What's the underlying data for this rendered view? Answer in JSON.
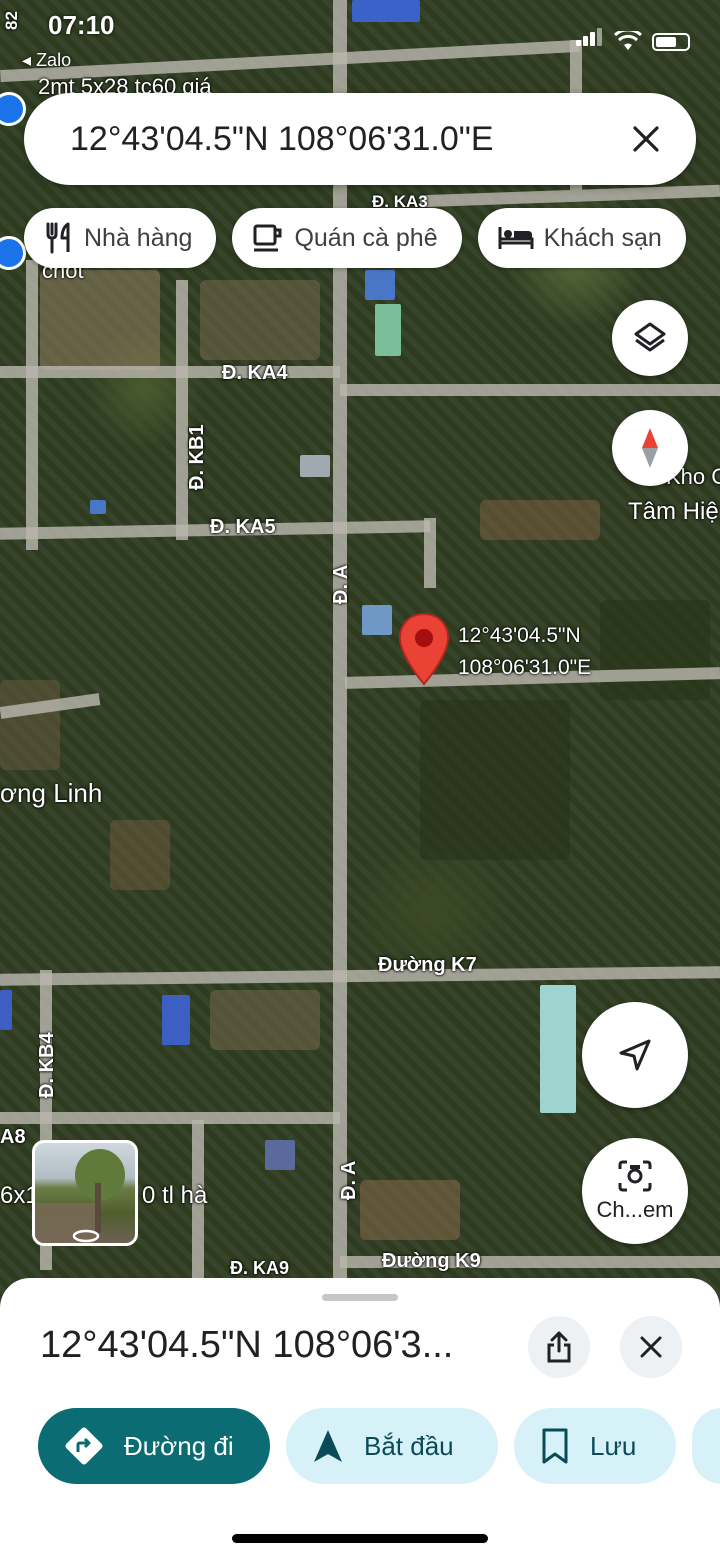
{
  "status": {
    "time": "07:10",
    "back_app": "Zalo"
  },
  "search": {
    "query": "12°43'04.5\"N 108°06'31.0\"E"
  },
  "chips": [
    {
      "icon": "restaurant-icon",
      "label": "Nhà hàng"
    },
    {
      "icon": "coffee-icon",
      "label": "Quán cà phê"
    },
    {
      "icon": "hotel-bed-icon",
      "label": "Khách sạn"
    }
  ],
  "map": {
    "labels": {
      "top_snippet": "2mt 5x28 tc60 giá",
      "chot": "chốt",
      "ka3": "Đ. KA3",
      "ka4": "Đ. KA4",
      "kb1": "Đ. KB1",
      "ka5": "Đ. KA5",
      "da_top": "Đ. A",
      "da_bottom": "Đ. A",
      "kho": "Kho C",
      "tam_hiep": "Tâm Hiệ",
      "linh": "ơng Linh",
      "k7": "Đường K7",
      "kb4": "Đ. KB4",
      "a8": "A8",
      "snippet_6x": "6x1",
      "snippet_tl": "0 tl hà",
      "ka9": "Đ. KA9",
      "k9": "Đường K9",
      "num_82": "82"
    },
    "pin_label_line1": "12°43'04.5\"N",
    "pin_label_line2": "108°06'31.0\"E",
    "camera_button_label": "Ch...em"
  },
  "sheet": {
    "title": "12°43'04.5\"N 108°06'3...",
    "actions": [
      {
        "icon": "directions-icon",
        "label": "Đường đi"
      },
      {
        "icon": "navigation-arrow-icon",
        "label": "Bắt đầu"
      },
      {
        "icon": "bookmark-icon",
        "label": "Lưu"
      }
    ]
  },
  "colors": {
    "primary_action": "#0b6c74",
    "secondary_action": "#d6f1f7",
    "pin": "#ea4335"
  }
}
